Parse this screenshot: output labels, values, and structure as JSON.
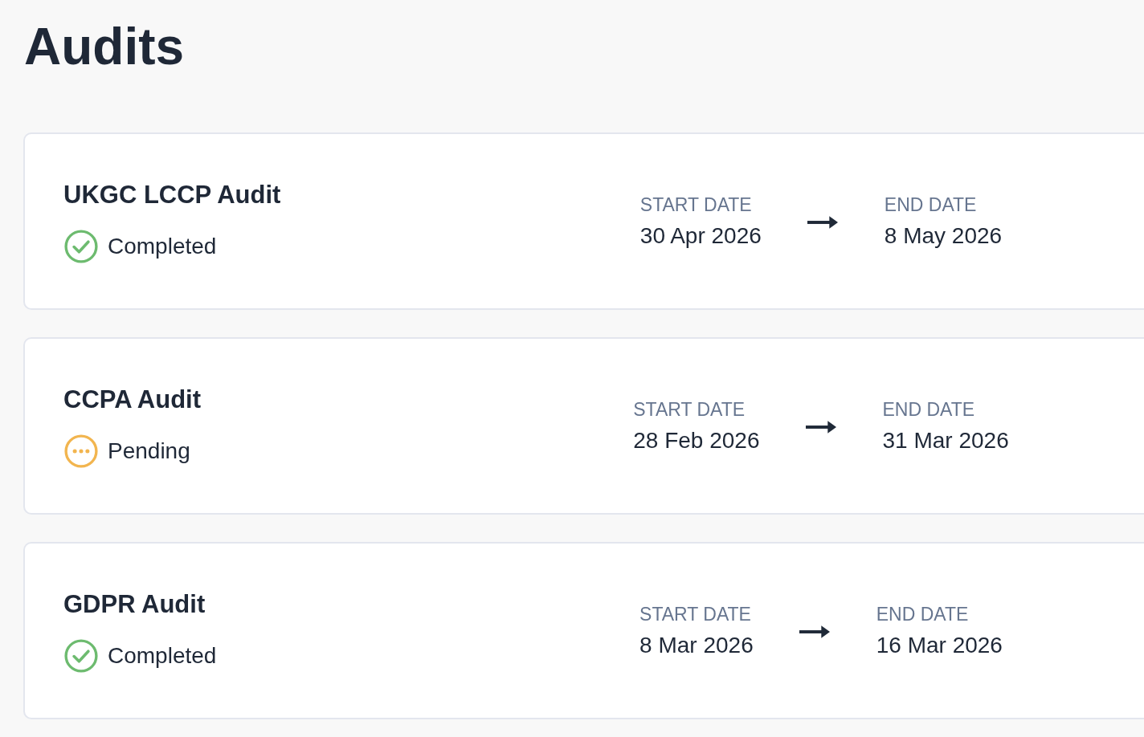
{
  "page": {
    "title": "Audits"
  },
  "audits": [
    {
      "name": "UKGC LCCP Audit",
      "status": {
        "kind": "completed",
        "label": "Completed",
        "color": "#6dbb6f"
      },
      "start": {
        "label": "START DATE",
        "date": "30 Apr 2026"
      },
      "end": {
        "label": "END DATE",
        "date": "8 May 2026"
      }
    },
    {
      "name": "CCPA Audit",
      "status": {
        "kind": "pending",
        "label": "Pending",
        "color": "#f2b54f"
      },
      "start": {
        "label": "START DATE",
        "date": "28 Feb 2026"
      },
      "end": {
        "label": "END DATE",
        "date": "31 Mar 2026"
      }
    },
    {
      "name": "GDPR Audit",
      "status": {
        "kind": "completed",
        "label": "Completed",
        "color": "#6dbb6f"
      },
      "start": {
        "label": "START DATE",
        "date": "8 Mar 2026"
      },
      "end": {
        "label": "END DATE",
        "date": "16 Mar 2026"
      }
    }
  ]
}
